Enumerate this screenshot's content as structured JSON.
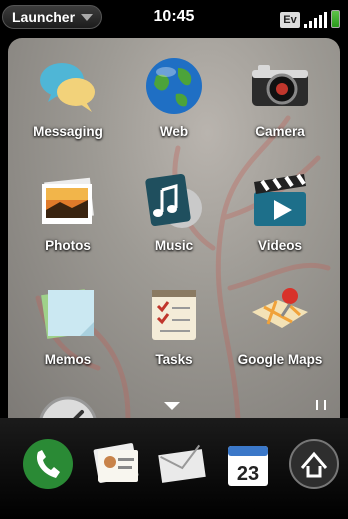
{
  "status_bar": {
    "menu_label": "Launcher",
    "clock": "10:45",
    "network_badge": "Ev",
    "signal_icon": "signal-bars-icon",
    "battery_icon": "battery-icon"
  },
  "apps": [
    {
      "label": "Messaging",
      "icon": "speech-bubbles-icon"
    },
    {
      "label": "Web",
      "icon": "globe-icon"
    },
    {
      "label": "Camera",
      "icon": "camera-icon"
    },
    {
      "label": "Photos",
      "icon": "photos-icon"
    },
    {
      "label": "Music",
      "icon": "music-note-icon"
    },
    {
      "label": "Videos",
      "icon": "clapperboard-icon"
    },
    {
      "label": "Memos",
      "icon": "memo-icon"
    },
    {
      "label": "Tasks",
      "icon": "checklist-icon"
    },
    {
      "label": "Google Maps",
      "icon": "map-pin-icon"
    },
    {
      "label": "",
      "icon": "clock-icon"
    }
  ],
  "dock": [
    {
      "icon": "phone-icon"
    },
    {
      "icon": "contacts-icon"
    },
    {
      "icon": "email-icon"
    },
    {
      "icon": "calendar-icon",
      "text": "23"
    },
    {
      "icon": "launcher-home-icon"
    }
  ],
  "colors": {
    "status_bar_bg": "#000000",
    "label_text": "#ffffff",
    "card_bg": "#9d9a94"
  }
}
